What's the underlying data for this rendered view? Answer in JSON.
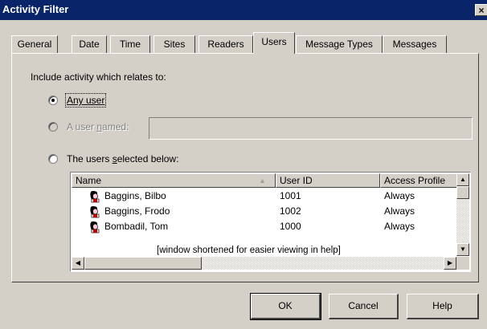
{
  "window": {
    "title": "Activity Filter",
    "close_glyph": "×"
  },
  "tabs": [
    {
      "label": "General"
    },
    {
      "label": "Date"
    },
    {
      "label": "Time"
    },
    {
      "label": "Sites"
    },
    {
      "label": "Readers"
    },
    {
      "label": "Users",
      "active": true
    },
    {
      "label": "Message Types"
    },
    {
      "label": "Messages"
    }
  ],
  "users_tab": {
    "heading": "Include activity which relates to:",
    "radio_any_user": {
      "label": "Any user",
      "selected": true
    },
    "radio_named_user": {
      "label_pre": "A user ",
      "label_accel": "n",
      "label_post": "amed:",
      "enabled": false
    },
    "named_user_value": "",
    "radio_selected_users": {
      "label_pre": "The users ",
      "label_accel": "s",
      "label_post": "elected below:",
      "selected": false
    },
    "list": {
      "columns": [
        "Name",
        "User ID",
        "Access Profile"
      ],
      "sort_indicator": "▲",
      "rows": [
        {
          "name": "Baggins, Bilbo",
          "user_id": "1001",
          "access_profile": "Always",
          "icon": "user-icon"
        },
        {
          "name": "Baggins, Frodo",
          "user_id": "1002",
          "access_profile": "Always",
          "icon": "user-icon"
        },
        {
          "name": "Bombadil, Tom",
          "user_id": "1000",
          "access_profile": "Always",
          "icon": "user-icon"
        }
      ],
      "note": "[window shortened for easier viewing in help]"
    }
  },
  "buttons": {
    "ok": "OK",
    "cancel": "Cancel",
    "help": "Help"
  },
  "colors": {
    "titlebar": "#0a246a",
    "face": "#d4d0c8",
    "icon_hair": "#000000",
    "icon_skin": "#ffccdd"
  }
}
